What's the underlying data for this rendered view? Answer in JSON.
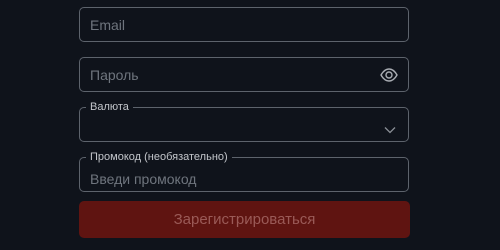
{
  "form": {
    "email": {
      "placeholder": "Email",
      "value": ""
    },
    "password": {
      "placeholder": "Пароль",
      "value": ""
    },
    "currency": {
      "label": "Валюта",
      "value": ""
    },
    "promo": {
      "label": "Промокод (необязательно)",
      "placeholder": "Введи промокод",
      "value": ""
    },
    "submit_label": "Зарегистрироваться"
  },
  "icons": {
    "password_toggle": "eye-icon",
    "currency_dropdown": "chevron-down-icon"
  },
  "colors": {
    "background": "#0f131b",
    "field_border": "#5d636c",
    "submit_background": "#5f1411",
    "submit_text": "#9a5a57"
  }
}
